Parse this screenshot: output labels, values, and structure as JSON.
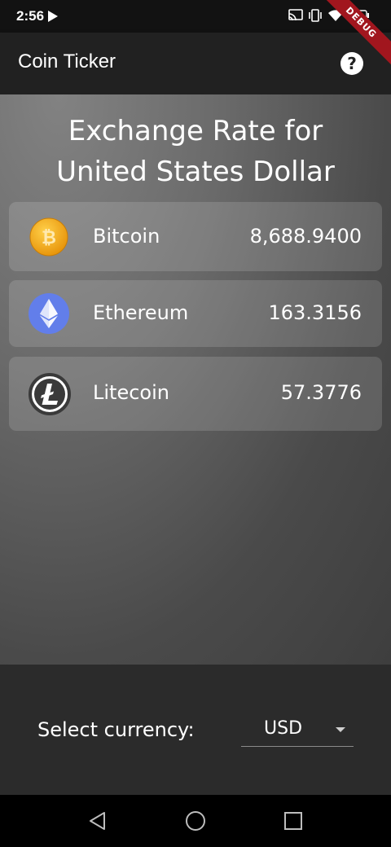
{
  "status_bar": {
    "time": "2:56",
    "icons": [
      "play-icon",
      "cast-icon",
      "vibrate-icon",
      "wifi-icon",
      "battery-icon"
    ],
    "battery": "50",
    "debug_banner": "DEBUG"
  },
  "app_bar": {
    "title": "Coin Ticker",
    "help_icon": "help-icon"
  },
  "main": {
    "heading_line1": "Exchange Rate for",
    "heading_line2": "United States Dollar",
    "coins": [
      {
        "name": "Bitcoin",
        "rate": "8,688.9400",
        "icon": "bitcoin-icon",
        "color": "#f2a516"
      },
      {
        "name": "Ethereum",
        "rate": "163.3156",
        "icon": "ethereum-icon",
        "color": "#627eea"
      },
      {
        "name": "Litecoin",
        "rate": "57.3776",
        "icon": "litecoin-icon",
        "color": "#3a3a3a"
      }
    ]
  },
  "currency_picker": {
    "label": "Select currency:",
    "selected": "USD"
  },
  "nav_bar": {
    "buttons": [
      "back-icon",
      "home-icon",
      "recents-icon"
    ]
  }
}
